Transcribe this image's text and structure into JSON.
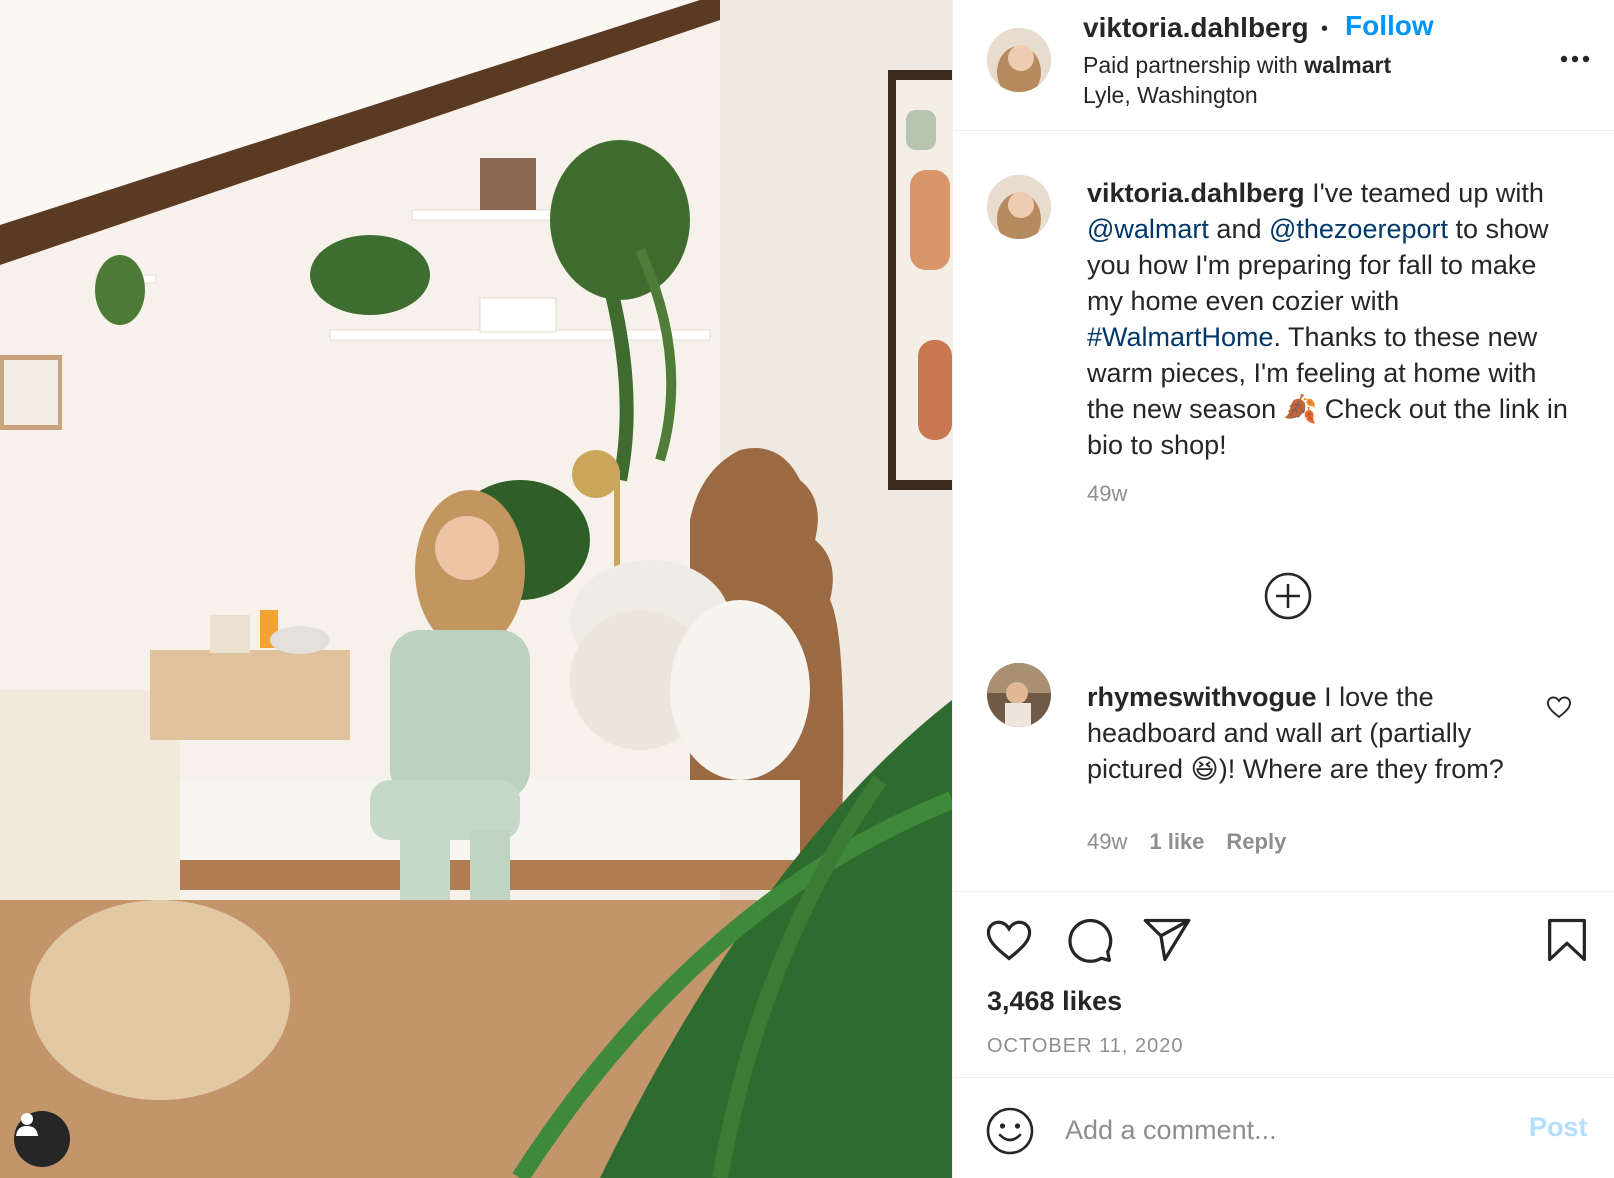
{
  "post": {
    "username": "viktoria.dahlberg",
    "follow_label": "Follow",
    "separator": "•",
    "partnership_prefix": "Paid partnership with",
    "partner": "walmart",
    "location": "Lyle, Washington"
  },
  "caption": {
    "username": "viktoria.dahlberg",
    "text_1": " I've teamed up with ",
    "mention_1": "@walmart",
    "text_2": " and ",
    "mention_2": "@thezoereport",
    "text_3": " to show you how I'm preparing for fall to make my home even cozier with ",
    "hashtag": "#WalmartHome",
    "text_4": ". Thanks to these new warm pieces, I'm feeling at home with the new season 🍂 Check out the link in bio to shop!",
    "age": "49w"
  },
  "comment": {
    "username": "rhymeswithvogue",
    "text": " I love the headboard and wall art (partially pictured 😆)! Where are they from?",
    "age": "49w",
    "likes": "1 like",
    "reply": "Reply"
  },
  "stats": {
    "likes": "3,468 likes",
    "date": "OCTOBER 11, 2020"
  },
  "composer": {
    "placeholder": "Add a comment...",
    "post_label": "Post"
  },
  "icons": {
    "more": "more-options-icon",
    "load_more": "load-more-comments-icon",
    "like": "heart-icon",
    "comment": "comment-icon",
    "share": "send-icon",
    "save": "bookmark-icon",
    "emoji": "emoji-icon",
    "user_tags": "user-icon"
  },
  "colors": {
    "follow": "#0095f6",
    "link": "#00376b",
    "muted": "#8e8e8e",
    "post_disabled": "#b2dffc"
  }
}
